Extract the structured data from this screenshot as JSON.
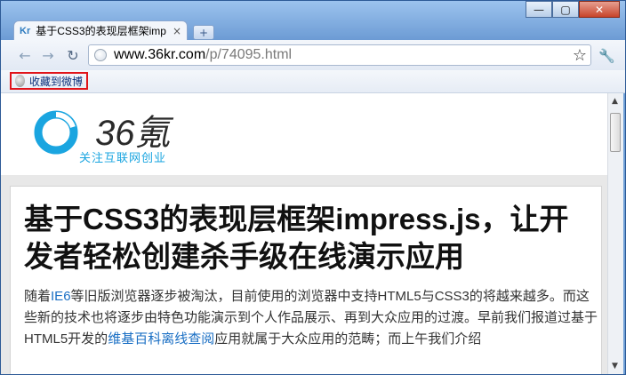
{
  "browser": {
    "tab_favicon": "Kr",
    "tab_title": "基于CSS3的表现层框架imp",
    "tab_close": "×",
    "new_tab": "+",
    "url_host": "www.36kr.com",
    "url_path": "/p/74095.html",
    "window_minimize": "—",
    "window_maximize": "▢",
    "window_close": "✕"
  },
  "bookmarks": {
    "item_label": "收藏到微博"
  },
  "site": {
    "logo_text": "36氪",
    "logo_tagline": "关注互联网创业",
    "brand_color": "#1aa5e0"
  },
  "article": {
    "headline": "基于CSS3的表现层框架impress.js，让开发者轻松创建杀手级在线演示应用",
    "p_part1": "随着",
    "p_link1": "IE6",
    "p_part2": "等旧版浏览器逐步被淘汰，目前使用的浏览器中支持HTML5与CSS3的将越来越多。而这些新的技术也将逐步由特色功能演示到个人作品展示、再到大众应用的过渡。早前我们报道过基于HTML5开发的",
    "p_link2": "维基百科离线查阅",
    "p_part3": "应用就属于大众应用的范畴；而上午我们介绍"
  }
}
